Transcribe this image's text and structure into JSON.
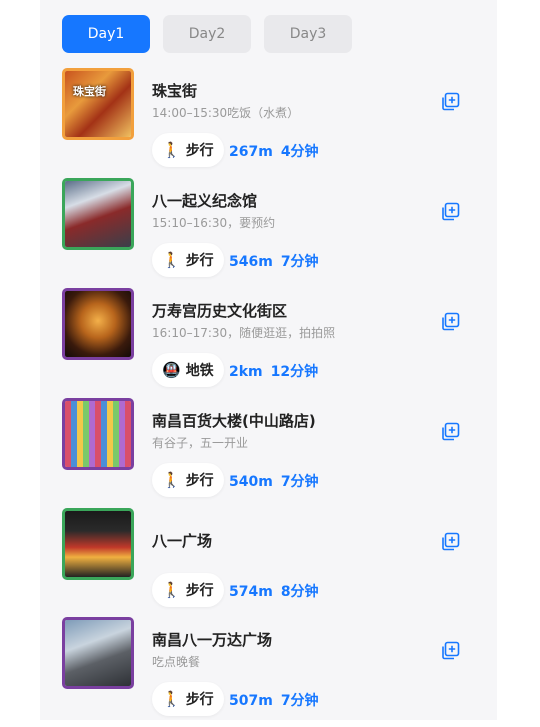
{
  "tabs": [
    {
      "label": "Day1",
      "active": true
    },
    {
      "label": "Day2",
      "active": false
    },
    {
      "label": "Day3",
      "active": false
    }
  ],
  "stops": [
    {
      "name": "珠宝街",
      "desc": "14:00–15:30吃饭（水煮）",
      "thumb_sign": "珠宝街",
      "border_color": "#f2a03d",
      "transport": {
        "icon": "walk-icon",
        "glyph": "🚶",
        "mode": "步行",
        "distance": "267m",
        "duration": "4分钟"
      }
    },
    {
      "name": "八一起义纪念馆",
      "desc": "15:10–16:30，要预约",
      "thumb_sign": "",
      "border_color": "#3aa65a",
      "transport": {
        "icon": "walk-icon",
        "glyph": "🚶",
        "mode": "步行",
        "distance": "546m",
        "duration": "7分钟"
      }
    },
    {
      "name": "万寿宫历史文化街区",
      "desc": "16:10–17:30，随便逛逛，拍拍照",
      "thumb_sign": "",
      "border_color": "#7a3fa0",
      "transport": {
        "icon": "metro-icon",
        "glyph": "🚇",
        "mode": "地铁",
        "distance": "2km",
        "duration": "12分钟"
      }
    },
    {
      "name": "南昌百货大楼(中山路店)",
      "desc": "有谷子，五一开业",
      "thumb_sign": "",
      "border_color": "#7a3fa0",
      "transport": {
        "icon": "walk-icon",
        "glyph": "🚶",
        "mode": "步行",
        "distance": "540m",
        "duration": "7分钟"
      }
    },
    {
      "name": "八一广场",
      "desc": "",
      "thumb_sign": "",
      "border_color": "#3aa65a",
      "transport": {
        "icon": "walk-icon",
        "glyph": "🚶",
        "mode": "步行",
        "distance": "574m",
        "duration": "8分钟"
      }
    },
    {
      "name": "南昌八一万达广场",
      "desc": "吃点晚餐",
      "thumb_sign": "",
      "border_color": "#7a3fa0",
      "transport": {
        "icon": "walk-icon",
        "glyph": "🚶",
        "mode": "步行",
        "distance": "507m",
        "duration": "7分钟"
      }
    }
  ],
  "colors": {
    "accent": "#1677ff",
    "tab_inactive": "#e9e9ec"
  }
}
